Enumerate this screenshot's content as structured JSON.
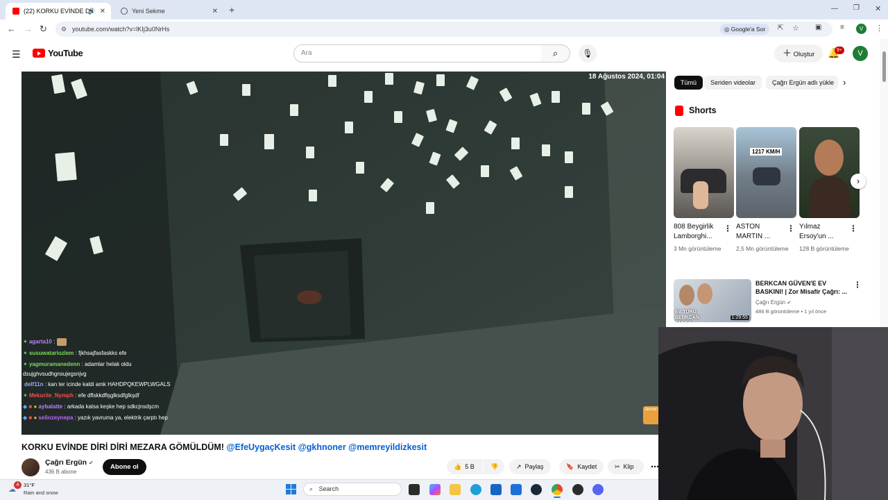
{
  "browser": {
    "tabs": [
      {
        "label": "(22) KORKU EVİNDE DİRİ D",
        "active": true
      },
      {
        "label": "Yeni Sekme",
        "active": false
      }
    ],
    "new_tab": "+",
    "url": "youtube.com/watch?v=lKIj3u0NrHs",
    "google_chip": "Google'a Sor",
    "profile_letter": "V"
  },
  "youtube": {
    "logo_text": "YouTube",
    "search_placeholder": "Ara",
    "create_label": "Oluştur",
    "notif_count": "9+",
    "avatar_letter": "V"
  },
  "video": {
    "overlay_date": "18 Ağustos 2024, 01:04",
    "watermark": "Abone ol",
    "chat": [
      {
        "name": "agarta10",
        "msg": ":",
        "name_color": "#b983ff"
      },
      {
        "name": "susuwatariozlem",
        "msg": ": fjkhsajfasfaskks efe",
        "name_color": "#7ddc54"
      },
      {
        "name": "yagmuramanedenn",
        "msg": ": adamlar helak oldu",
        "name_color": "#7ddc54"
      },
      {
        "name": "",
        "msg": "dsujghvsudhgnsujegsnjvg",
        "name_color": "#ffffff"
      },
      {
        "name": "delf11n",
        "msg": ": kan ter icinde kaldi amk HAHDPQKEWPLWGALS",
        "name_color": "#9aa8ff"
      },
      {
        "name": "Mekurile_Nymph",
        "msg": ": efe dflskkdflşglksdfglkşdf",
        "name_color": "#ff4a4a"
      },
      {
        "name": "aybalatte",
        "msg": ": arkada kalsa keşke hep sdkcjnsdşcm",
        "name_color": "#b983ff"
      },
      {
        "name": "selinzeynepa",
        "msg": ": yazık yavruma ya, elektrik çarptı hep",
        "name_color": "#c266ff"
      }
    ]
  },
  "filters": [
    "Tümü",
    "Seriden videolar",
    "Çağrı Ergün adlı yükle"
  ],
  "shorts": {
    "heading": "Shorts",
    "items": [
      {
        "title": "808 Beygirlik Lamborghi...",
        "views": "3 Mn görüntüleme",
        "overlay": ""
      },
      {
        "title": "ASTON MARTIN ...",
        "views": "2,5 Mn görüntüleme",
        "overlay": "1217 KM/H"
      },
      {
        "title": "Yılmaz Ersoy'un ...",
        "views": "128 B görüntüleme",
        "overlay": ""
      }
    ]
  },
  "recommended": {
    "title": "BERKCAN GÜVEN'E EV BASKINI! | Zor Misafir Çağrı: ...",
    "channel": "Çağrı Ergün",
    "meta": "486 B görüntüleme • 1 yıl önce",
    "duration": "1:29:55",
    "thumb_text": "EV TURU BERKCAN GÜVEN"
  },
  "main": {
    "title_plain": "KORKU EVİNDE DİRİ DİRİ MEZARA GÖMÜLDÜM!",
    "title_links": "@EfeUygaçKesit @gkhnoner @memreyildizkesit",
    "channel_name": "Çağrı Ergün",
    "subscribers": "436 B abone",
    "subscribe_label": "Abone ol",
    "likes": "5 B",
    "share": "Paylaş",
    "save": "Kaydet",
    "clip": "Klip"
  },
  "taskbar": {
    "weather_temp": "31°F",
    "weather_desc": "Rain and snow",
    "weather_badge": "4",
    "search_label": "Search"
  },
  "colors": {
    "yt_red": "#ff0000",
    "link_blue": "#065fd4",
    "tabbar": "#dfe6f3"
  }
}
